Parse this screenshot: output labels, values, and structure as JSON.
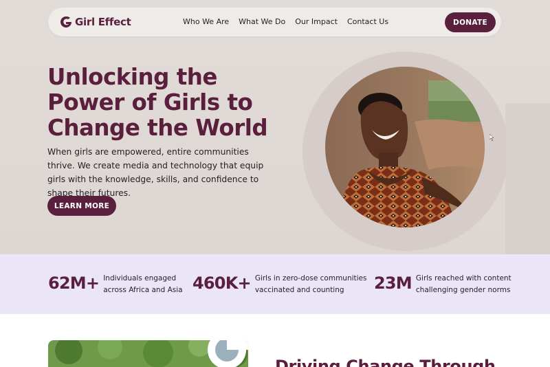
{
  "colors": {
    "brand": "#5a1f3c",
    "hero_bg": "#e0dad6",
    "stats_bg": "#ebe6f7"
  },
  "nav": {
    "logo_text": "Girl Effect",
    "links": [
      "Who We Are",
      "What We Do",
      "Our Impact",
      "Contact Us"
    ],
    "donate_label": "DONATE"
  },
  "hero": {
    "headline": [
      "Unlocking the",
      "Power of Girls to",
      "Change the World"
    ],
    "lead": "When girls are empowered, entire communities thrive. We create media and technology that equip girls with the knowledge, skills, and confidence to shape their futures.",
    "cta_label": "LEARN MORE"
  },
  "stats": [
    {
      "value": "62M+",
      "label_line1": "Individuals engaged",
      "label_line2": "across Africa and Asia"
    },
    {
      "value": "460K+",
      "label_line1": "Girls in zero-dose communities",
      "label_line2": "vaccinated and counting"
    },
    {
      "value": "23M",
      "label_line1": "Girls reached with content",
      "label_line2": "challenging gender norms"
    }
  ],
  "next_section": {
    "heading": "Driving Change Through"
  },
  "icons": [
    "girl-effect-logo-icon",
    "cursor-icon"
  ]
}
